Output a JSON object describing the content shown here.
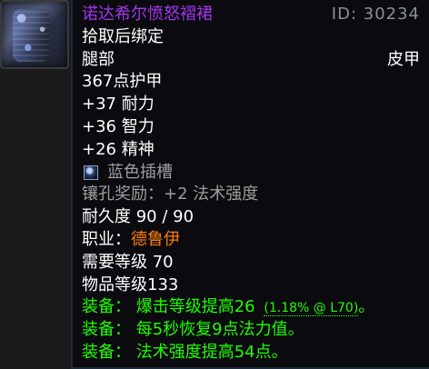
{
  "item": {
    "name": "诺达希尔愤怒褶裙",
    "id_text": "ID: 30234",
    "bind_text": "拾取后绑定",
    "slot": "腿部",
    "armor_type": "皮甲",
    "armor": "367点护甲",
    "stats": [
      "+37 耐力",
      "+36 智力",
      "+26 精神"
    ],
    "socket": {
      "icon": "blue-socket-icon",
      "label": "蓝色插槽"
    },
    "socket_bonus": "镶孔奖励：+2 法术强度",
    "durability_label": "耐久度",
    "durability_value": "90 / 90",
    "class_label": "职业：",
    "class_name": "德鲁伊",
    "required_level": "需要等级 70",
    "item_level": "物品等级133",
    "equip_effects": [
      {
        "text": "装备： 爆击等级提高26",
        "extra": "(1.18% @ L70)",
        "suffix": "。"
      },
      {
        "text": "装备： 每5秒恢复9点法力值。",
        "extra": "",
        "suffix": ""
      },
      {
        "text": "装备： 法术强度提高54点。",
        "extra": "",
        "suffix": ""
      }
    ]
  },
  "colors": {
    "epic": "#a335ee",
    "equip": "#1eff00",
    "class": "#ff7d0a",
    "muted": "#9d9d9d"
  }
}
